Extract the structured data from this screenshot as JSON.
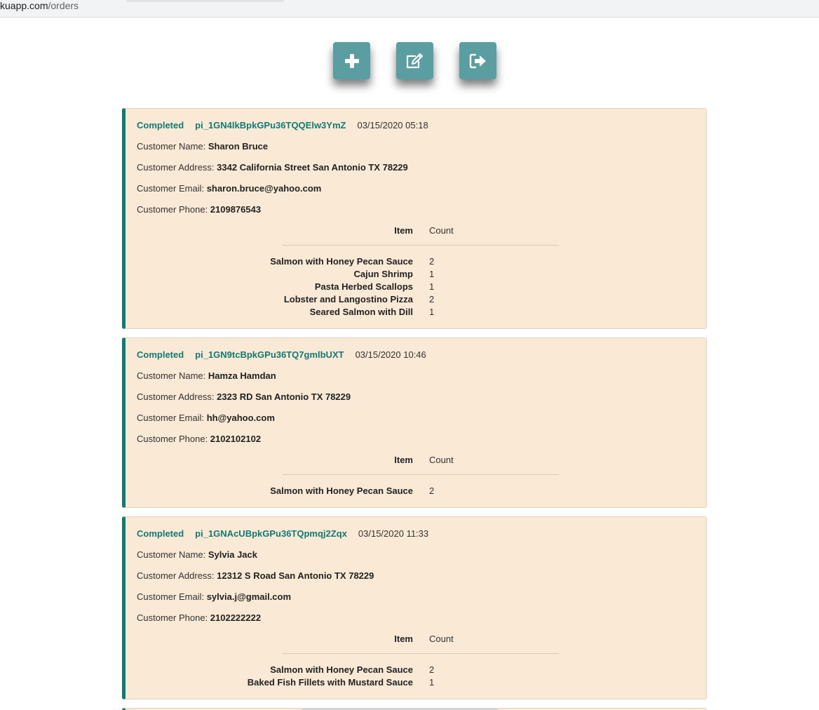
{
  "browser": {
    "url_host": "kuapp.com",
    "url_path": "/orders"
  },
  "toolbar": {
    "buttons": [
      {
        "name": "add-button",
        "icon": "plus-icon"
      },
      {
        "name": "edit-button",
        "icon": "edit-icon"
      },
      {
        "name": "logout-button",
        "icon": "sign-out-icon"
      }
    ]
  },
  "labels": {
    "customer_name": "Customer Name: ",
    "customer_address": "Customer Address: ",
    "customer_email": "Customer Email: ",
    "customer_phone": "Customer Phone: ",
    "item_header": "Item",
    "count_header": "Count"
  },
  "orders": [
    {
      "status": "Completed",
      "id": "pi_1GN4lkBpkGPu36TQQElw3YmZ",
      "date": "03/15/2020 05:18",
      "name": "Sharon Bruce",
      "address": "3342 California Street San Antonio TX 78229",
      "email": "sharon.bruce@yahoo.com",
      "phone": "2109876543",
      "items": [
        {
          "name": "Salmon with Honey Pecan Sauce",
          "count": "2"
        },
        {
          "name": "Cajun Shrimp",
          "count": "1"
        },
        {
          "name": "Pasta Herbed Scallops",
          "count": "1"
        },
        {
          "name": "Lobster and Langostino Pizza",
          "count": "2"
        },
        {
          "name": "Seared Salmon with Dill",
          "count": "1"
        }
      ]
    },
    {
      "status": "Completed",
      "id": "pi_1GN9tcBpkGPu36TQ7gmlbUXT",
      "date": "03/15/2020 10:46",
      "name": "Hamza Hamdan",
      "address": "2323 RD San Antonio TX 78229",
      "email": "hh@yahoo.com",
      "phone": "2102102102",
      "items": [
        {
          "name": "Salmon with Honey Pecan Sauce",
          "count": "2"
        }
      ]
    },
    {
      "status": "Completed",
      "id": "pi_1GNAcUBpkGPu36TQpmqj2Zqx",
      "date": "03/15/2020 11:33",
      "name": "Sylvia Jack",
      "address": "12312 S Road San Antonio TX 78229",
      "email": "sylvia.j@gmail.com",
      "phone": "2102222222",
      "items": [
        {
          "name": "Salmon with Honey Pecan Sauce",
          "count": "2"
        },
        {
          "name": "Baked Fish Fillets with Mustard Sauce",
          "count": "1"
        }
      ]
    }
  ],
  "colors": {
    "accent": "#117a74",
    "button": "#5b9ea1",
    "card_bg": "#f9e9d5"
  }
}
